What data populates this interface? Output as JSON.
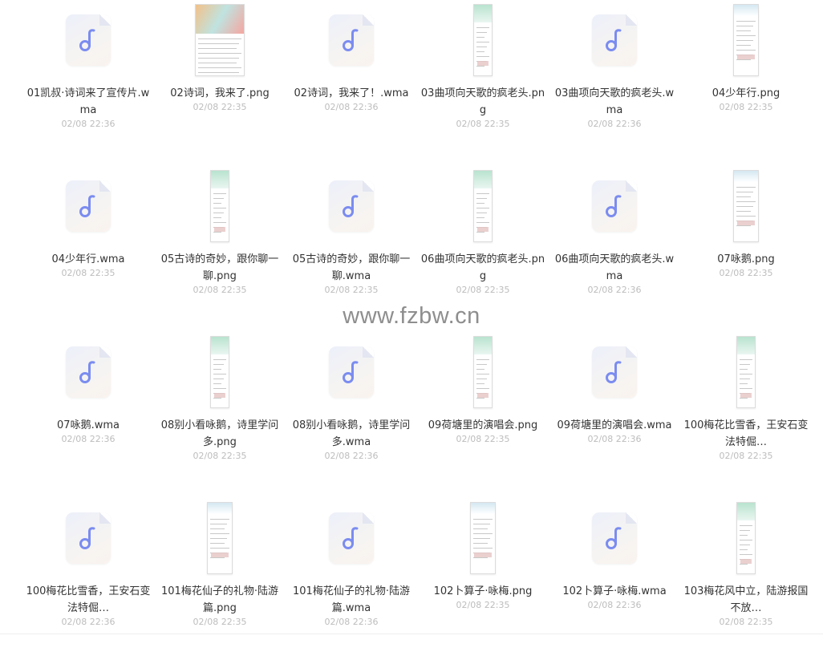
{
  "watermark": "www.fzbw.cn",
  "files": [
    {
      "name": "01凯叔·诗词来了宣传片.wma",
      "time": "02/08 22:36",
      "kind": "audio"
    },
    {
      "name": "02诗词，我来了.png",
      "time": "02/08 22:35",
      "kind": "image",
      "thumb": "wide"
    },
    {
      "name": "02诗词，我来了！.wma",
      "time": "02/08 22:36",
      "kind": "audio"
    },
    {
      "name": "03曲项向天歌的疯老头.png",
      "time": "02/08 22:35",
      "kind": "image",
      "thumb": "narrow"
    },
    {
      "name": "03曲项向天歌的疯老头.wma",
      "time": "02/08 22:36",
      "kind": "audio"
    },
    {
      "name": "04少年行.png",
      "time": "02/08 22:35",
      "kind": "image",
      "thumb": "mid"
    },
    {
      "name": "04少年行.wma",
      "time": "02/08 22:35",
      "kind": "audio"
    },
    {
      "name": "05古诗的奇妙，跟你聊一聊.png",
      "time": "02/08 22:35",
      "kind": "image",
      "thumb": "narrow"
    },
    {
      "name": "05古诗的奇妙，跟你聊一聊.wma",
      "time": "02/08 22:35",
      "kind": "audio"
    },
    {
      "name": "06曲项向天歌的疯老头.png",
      "time": "02/08 22:35",
      "kind": "image",
      "thumb": "narrow"
    },
    {
      "name": "06曲项向天歌的疯老头.wma",
      "time": "02/08 22:36",
      "kind": "audio"
    },
    {
      "name": "07咏鹅.png",
      "time": "02/08 22:35",
      "kind": "image",
      "thumb": "mid"
    },
    {
      "name": "07咏鹅.wma",
      "time": "02/08 22:36",
      "kind": "audio"
    },
    {
      "name": "08别小看咏鹅，诗里学问多.png",
      "time": "02/08 22:35",
      "kind": "image",
      "thumb": "narrow"
    },
    {
      "name": "08别小看咏鹅，诗里学问多.wma",
      "time": "02/08 22:36",
      "kind": "audio"
    },
    {
      "name": "09荷塘里的演唱会.png",
      "time": "02/08 22:35",
      "kind": "image",
      "thumb": "narrow"
    },
    {
      "name": "09荷塘里的演唱会.wma",
      "time": "02/08 22:36",
      "kind": "audio"
    },
    {
      "name": "100梅花比雪香，王安石变法特倔…",
      "time": "02/08 22:35",
      "kind": "image",
      "thumb": "narrow"
    },
    {
      "name": "100梅花比雪香，王安石变法特倔…",
      "time": "02/08 22:36",
      "kind": "audio"
    },
    {
      "name": "101梅花仙子的礼物·陆游篇.png",
      "time": "02/08 22:35",
      "kind": "image",
      "thumb": "mid"
    },
    {
      "name": "101梅花仙子的礼物·陆游篇.wma",
      "time": "02/08 22:36",
      "kind": "audio"
    },
    {
      "name": "102卜算子·咏梅.png",
      "time": "02/08 22:35",
      "kind": "image",
      "thumb": "mid"
    },
    {
      "name": "102卜算子·咏梅.wma",
      "time": "02/08 22:36",
      "kind": "audio"
    },
    {
      "name": "103梅花风中立，陆游报国不放…",
      "time": "02/08 22:35",
      "kind": "image",
      "thumb": "narrow"
    }
  ],
  "colors": {
    "audio_glyph": "#7b8cf0",
    "time": "#bdbdbd",
    "name": "#333333"
  },
  "icons": {
    "audio": "music-note-icon",
    "image": "image-thumbnail"
  }
}
